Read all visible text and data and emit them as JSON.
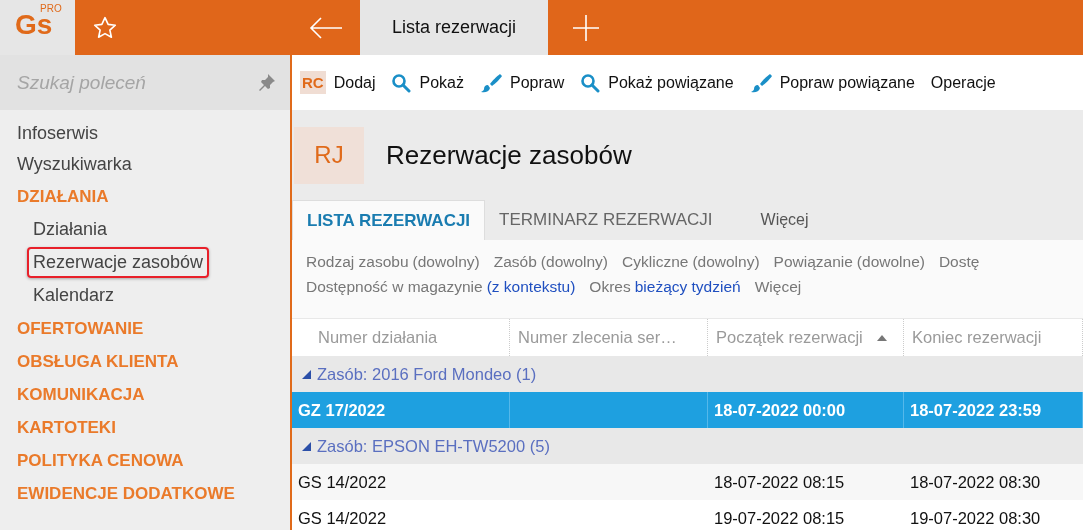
{
  "app": {
    "logo": "Gs",
    "logo_badge": "PRO"
  },
  "top_tabs": [
    {
      "label": "Lista rezerwacji",
      "selected": true
    }
  ],
  "sidebar": {
    "search": {
      "placeholder": "Szukaj poleceń"
    },
    "items": [
      {
        "label": "Infoserwis",
        "kind": "link"
      },
      {
        "label": "Wyszukiwarka",
        "kind": "link"
      },
      {
        "label": "DZIAŁANIA",
        "kind": "section",
        "children": [
          {
            "label": "Działania",
            "highlighted": false
          },
          {
            "label": "Rezerwacje zasobów",
            "highlighted": true
          },
          {
            "label": "Kalendarz",
            "highlighted": false
          }
        ]
      },
      {
        "label": "OFERTOWANIE",
        "kind": "section"
      },
      {
        "label": "OBSŁUGA KLIENTA",
        "kind": "section"
      },
      {
        "label": "KOMUNIKACJA",
        "kind": "section"
      },
      {
        "label": "KARTOTEKI",
        "kind": "section"
      },
      {
        "label": "POLITYKA CENOWA",
        "kind": "section"
      },
      {
        "label": "EWIDENCJE DODATKOWE",
        "kind": "section"
      }
    ]
  },
  "toolbar": [
    {
      "label": "Dodaj",
      "kind": "add",
      "badge": "RC"
    },
    {
      "label": "Pokaż",
      "kind": "show"
    },
    {
      "label": "Popraw",
      "kind": "edit"
    },
    {
      "label": "Pokaż powiązane",
      "kind": "show"
    },
    {
      "label": "Popraw powiązane",
      "kind": "edit"
    },
    {
      "label": "Operacje",
      "kind": "menu"
    }
  ],
  "header": {
    "badge": "RJ",
    "title": "Rezerwacje zasobów"
  },
  "tabs": [
    {
      "label": "LISTA REZERWACJI",
      "selected": true
    },
    {
      "label": "TERMINARZ REZERWACJI",
      "selected": false
    },
    {
      "label": "Więcej",
      "selected": false,
      "kind": "more"
    }
  ],
  "filters": [
    [
      {
        "label": "Rodzaj zasobu",
        "value": "(dowolny)",
        "set": false
      },
      {
        "label": "Zasób",
        "value": "(dowolny)",
        "set": false
      },
      {
        "label": "Cykliczne",
        "value": "(dowolny)",
        "set": false
      },
      {
        "label": "Powiązanie",
        "value": "(dowolne)",
        "set": false
      },
      {
        "label": "Dostę"
      }
    ],
    [
      {
        "label": "Dostępność w magazynie",
        "value": "(z kontekstu)",
        "set": true
      },
      {
        "label": "Okres",
        "value": "bieżący tydzień",
        "set": true
      },
      {
        "label": "Więcej"
      }
    ]
  ],
  "table": {
    "columns": [
      {
        "label": "Numer działania",
        "sorted": false
      },
      {
        "label": "Numer zlecenia ser…",
        "sorted": false
      },
      {
        "label": "Początek rezerwacji",
        "sorted": true
      },
      {
        "label": "Koniec rezerwacji",
        "sorted": false
      }
    ],
    "rows": [
      {
        "kind": "group",
        "label": "Zasób: 2016 Ford Mondeo (1)",
        "expanded": true
      },
      {
        "kind": "row",
        "selected": true,
        "cells": [
          "GZ 17/2022",
          "",
          "18-07-2022 00:00",
          "18-07-2022 23:59"
        ]
      },
      {
        "kind": "group",
        "label": "Zasób: EPSON EH-TW5200 (5)",
        "expanded": true
      },
      {
        "kind": "row",
        "selected": false,
        "cells": [
          "GS 14/2022",
          "",
          "18-07-2022 08:15",
          "18-07-2022 08:30"
        ]
      },
      {
        "kind": "row",
        "selected": false,
        "cells": [
          "GS 14/2022",
          "",
          "19-07-2022 08:15",
          "19-07-2022 08:30"
        ]
      }
    ]
  }
}
